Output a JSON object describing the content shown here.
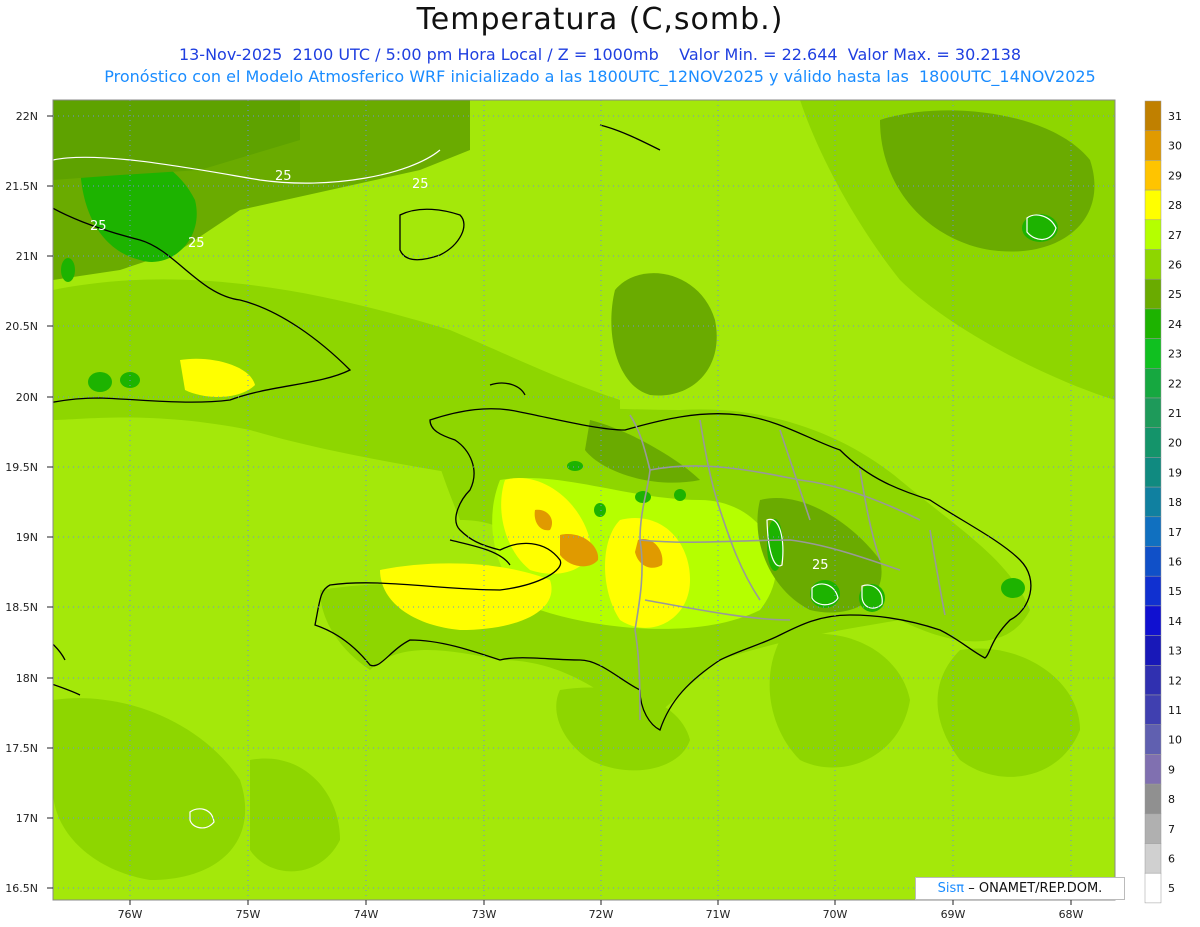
{
  "title": "Temperatura (C,somb.)",
  "subtitle_line1": "13-Nov-2025  2100 UTC / 5:00 pm Hora Local / Z = 1000mb    Valor Min. = 22.644  Valor Max. = 30.2138",
  "subtitle_line2": "Pronóstico con el Modelo Atmosferico WRF inicializado a las 1800UTC_12NOV2025 y válido hasta las  1800UTC_14NOV2025",
  "lat_labels": [
    "22N",
    "21.5N",
    "21N",
    "20.5N",
    "20N",
    "19.5N",
    "19N",
    "18.5N",
    "18N",
    "17.5N",
    "17N",
    "16.5N"
  ],
  "lon_labels": [
    "76W",
    "75W",
    "74W",
    "73W",
    "72W",
    "71W",
    "70W",
    "69W",
    "68W"
  ],
  "contour_label": "25",
  "credit": {
    "brand": "Sisπ",
    "text": "– ONAMET/REP.DOM."
  },
  "colorbar": {
    "levels": [
      "31",
      "30",
      "29",
      "28",
      "27",
      "26",
      "25",
      "24",
      "23",
      "22",
      "21",
      "20",
      "19",
      "18",
      "17",
      "16",
      "15",
      "14",
      "13",
      "12",
      "11",
      "10",
      "9",
      "8",
      "7",
      "6",
      "5"
    ],
    "colors": [
      "#c08000",
      "#e09a00",
      "#ffc400",
      "#ffff00",
      "#b5ff00",
      "#8ed600",
      "#6aab00",
      "#1db300",
      "#10c020",
      "#16a840",
      "#1e9a5a",
      "#14946a",
      "#108a80",
      "#1080a0",
      "#1070c0",
      "#1050c8",
      "#1030d0",
      "#1010d0",
      "#1818b8",
      "#3030b0",
      "#4040b0",
      "#6060b0",
      "#8070b0",
      "#909090",
      "#b0b0b0",
      "#d0d0d0",
      "#ffffff"
    ]
  },
  "colors": {
    "sea_base": "#a4e80a",
    "land_mid": "#8ed600",
    "dark_green": "#6aab00",
    "warm": "#ffff00",
    "warmer": "#ffc400",
    "hot": "#e09a00",
    "cool_spot": "#1db300"
  }
}
